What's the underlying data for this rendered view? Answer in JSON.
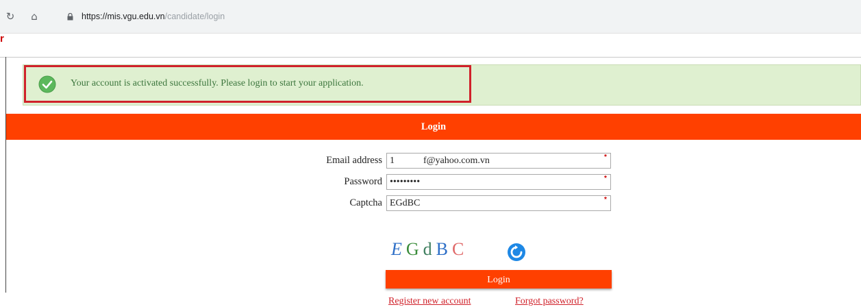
{
  "browser": {
    "url_host": "https://mis.vgu.edu.vn",
    "url_path": "/candidate/login",
    "favicon_letter": "r"
  },
  "alert": {
    "message": "Your account is activated successfully. Please login to start your application."
  },
  "login_panel": {
    "header": "Login"
  },
  "form": {
    "email_label": "Email address",
    "email_value": "1            f@yahoo.com.vn",
    "password_label": "Password",
    "password_value": "•••••••••",
    "captcha_label": "Captcha",
    "captcha_value": "EGdBC",
    "required_mark": "*"
  },
  "captcha_image": {
    "chars": [
      {
        "ch": "E",
        "color": "#2e6fc7",
        "style": "italic"
      },
      {
        "ch": "G",
        "color": "#3a8c3a",
        "style": "normal"
      },
      {
        "ch": "d",
        "color": "#3f7f5f",
        "style": "normal"
      },
      {
        "ch": "B",
        "color": "#2e6fc7",
        "style": "normal"
      },
      {
        "ch": "C",
        "color": "#e06a6a",
        "style": "normal"
      }
    ]
  },
  "actions": {
    "login_button": "Login",
    "register_link": "Register new account",
    "forgot_link": "Forgot password?"
  },
  "colors": {
    "accent": "#ff4000",
    "success_bg": "#dff0d0",
    "highlight": "#d0212a"
  },
  "icons": [
    "reload-icon",
    "home-icon",
    "lock-icon",
    "check-circle-icon",
    "refresh-captcha-icon"
  ]
}
